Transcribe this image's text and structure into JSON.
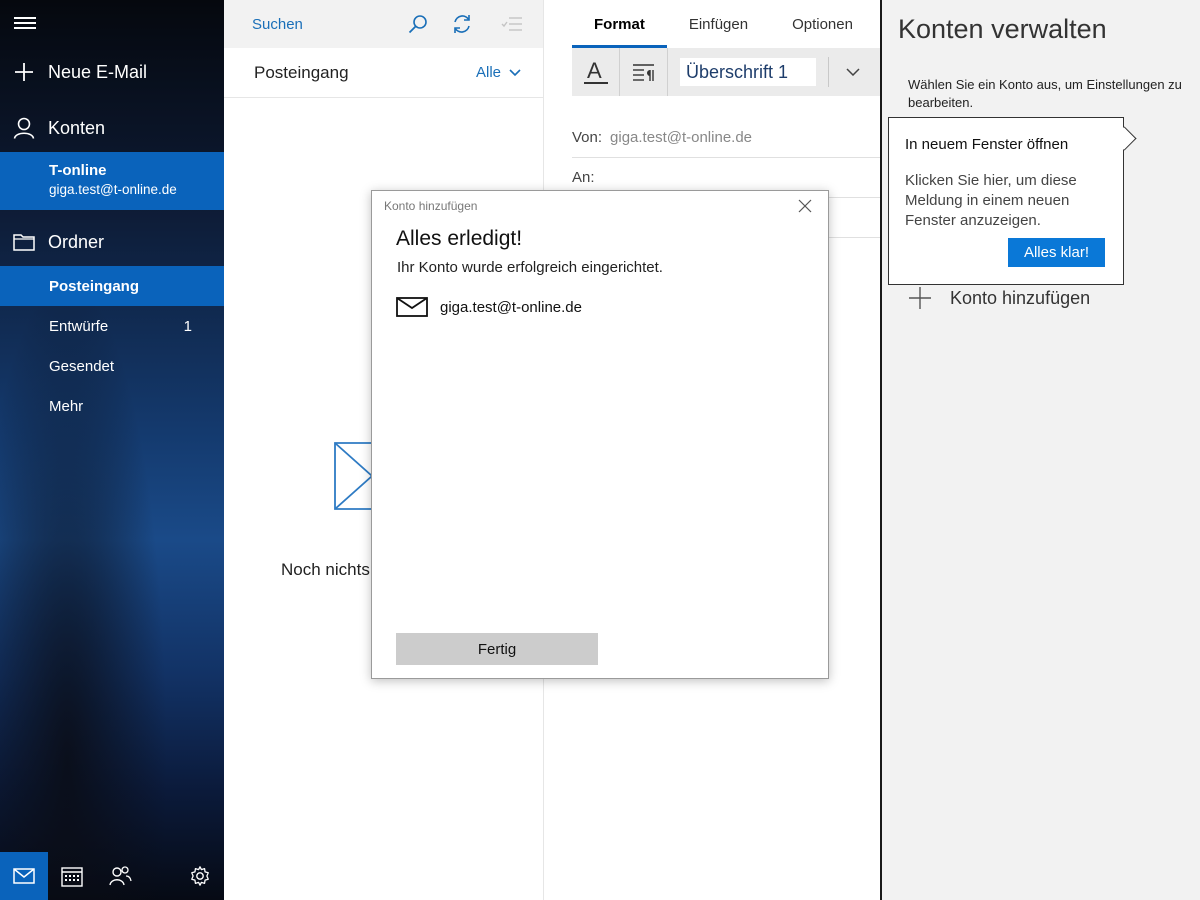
{
  "nav": {
    "new_mail": "Neue E-Mail",
    "accounts_label": "Konten",
    "account": {
      "name": "T-online",
      "email": "giga.test@t-online.de"
    },
    "folders_label": "Ordner",
    "folders": [
      {
        "label": "Posteingang",
        "count": ""
      },
      {
        "label": "Entwürfe",
        "count": "1"
      },
      {
        "label": "Gesendet",
        "count": ""
      },
      {
        "label": "Mehr",
        "count": ""
      }
    ],
    "bottom_icons": [
      "mail-icon",
      "calendar-icon",
      "people-icon",
      "settings-icon"
    ]
  },
  "list": {
    "search_placeholder": "Suchen",
    "folder_title": "Posteingang",
    "filter": "Alle",
    "empty_text": "Noch nichts"
  },
  "compose": {
    "tabs": [
      "Format",
      "Einfügen",
      "Optionen"
    ],
    "style_value": "Überschrift 1",
    "from_label": "Von:",
    "from_value": "giga.test@t-online.de",
    "to_label": "An:"
  },
  "manage": {
    "title": "Konten verwalten",
    "description": "Wählen Sie ein Konto aus, um Einstellungen zu bearbeiten.",
    "add_account": "Konto hinzufügen"
  },
  "tooltip": {
    "title": "In neuem Fenster öffnen",
    "body": "Klicken Sie hier, um diese Meldung in einem neuen Fenster anzuzeigen.",
    "button": "Alles klar!"
  },
  "dialog": {
    "window_title": "Konto hinzufügen",
    "heading": "Alles erledigt!",
    "message": "Ihr Konto wurde erfolgreich eingerichtet.",
    "account_email": "giga.test@t-online.de",
    "done_button": "Fertig"
  },
  "colors": {
    "accent": "#0a63bb",
    "link": "#1a6fb8",
    "button": "#0a78d7"
  }
}
